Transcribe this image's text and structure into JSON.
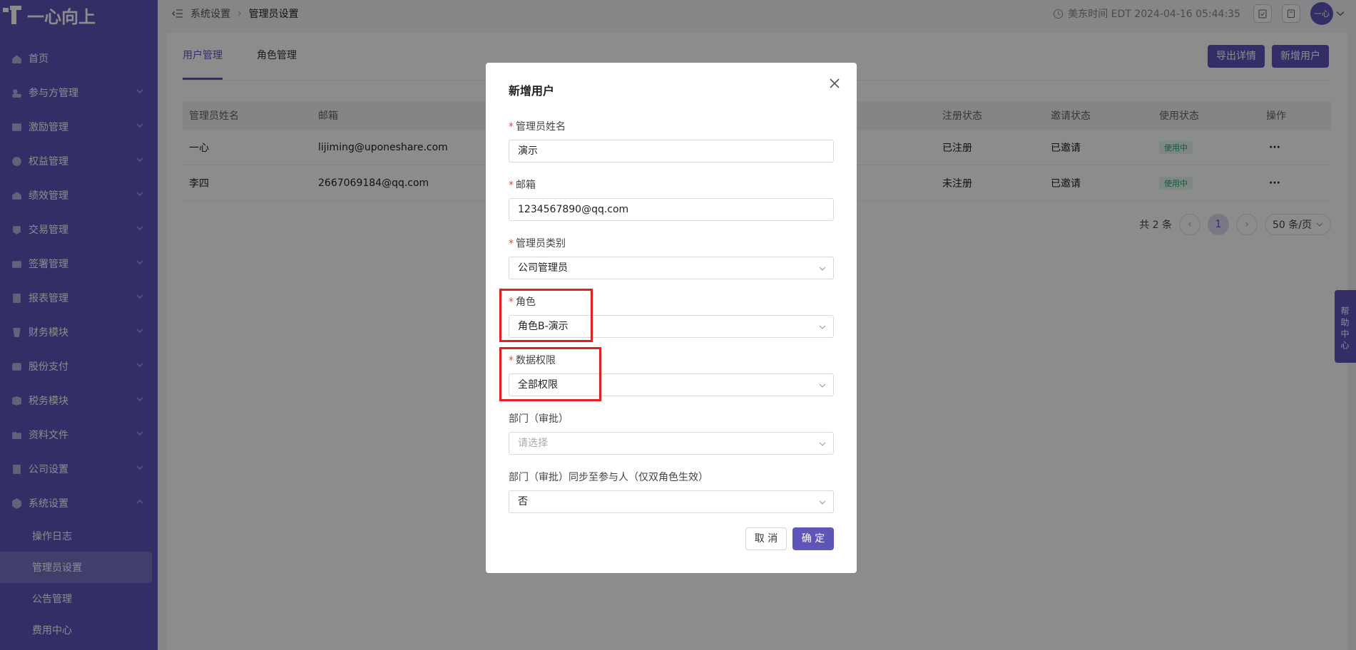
{
  "app": {
    "logo_text": "一心向上"
  },
  "sidebar": {
    "items": [
      {
        "label": "首页",
        "icon": "home-icon"
      },
      {
        "label": "参与方管理",
        "icon": "participants-icon"
      },
      {
        "label": "激励管理",
        "icon": "incentive-icon"
      },
      {
        "label": "权益管理",
        "icon": "equity-icon"
      },
      {
        "label": "绩效管理",
        "icon": "performance-icon"
      },
      {
        "label": "交易管理",
        "icon": "trade-icon"
      },
      {
        "label": "签署管理",
        "icon": "sign-icon"
      },
      {
        "label": "报表管理",
        "icon": "report-icon"
      },
      {
        "label": "财务模块",
        "icon": "finance-icon"
      },
      {
        "label": "股份支付",
        "icon": "share-payment-icon"
      },
      {
        "label": "税务模块",
        "icon": "tax-icon"
      },
      {
        "label": "资料文件",
        "icon": "files-icon"
      },
      {
        "label": "公司设置",
        "icon": "company-icon"
      },
      {
        "label": "系统设置",
        "icon": "system-icon"
      }
    ],
    "sub_items": [
      {
        "label": "操作日志"
      },
      {
        "label": "管理员设置"
      },
      {
        "label": "公告管理"
      },
      {
        "label": "费用中心"
      }
    ]
  },
  "header": {
    "breadcrumb_root": "系统设置",
    "breadcrumb_current": "管理员设置",
    "time_text": "美东时间 EDT 2024-04-16 05:44:35",
    "avatar_text": "一心"
  },
  "main": {
    "tabs": [
      {
        "label": "用户管理"
      },
      {
        "label": "角色管理"
      }
    ],
    "export_label": "导出详情",
    "add_label": "新增用户",
    "table": {
      "headers": {
        "name": "管理员姓名",
        "email": "邮箱",
        "reg": "注册状态",
        "invite": "邀请状态",
        "use": "使用状态",
        "op": "操作"
      },
      "rows": [
        {
          "name": "一心",
          "email": "lijiming@uponeshare.com",
          "reg": "已注册",
          "invite": "已邀请",
          "use": "使用中",
          "op": "···"
        },
        {
          "name": "李四",
          "email": "2667069184@qq.com",
          "reg": "未注册",
          "invite": "已邀请",
          "use": "使用中",
          "op": "···"
        }
      ]
    },
    "pager": {
      "total": "共 2 条",
      "page": "1",
      "size": "50 条/页"
    }
  },
  "help_text": "帮助中心",
  "modal": {
    "title": "新增用户",
    "fields": [
      {
        "label": "管理员姓名",
        "required": "*",
        "value": "演示"
      },
      {
        "label": "邮箱",
        "required": "*",
        "value": "1234567890@qq.com"
      },
      {
        "label": "管理员类别",
        "required": "*",
        "value": "公司管理员"
      },
      {
        "label": "角色",
        "required": "*",
        "value": "角色B-演示"
      },
      {
        "label": "数据权限",
        "required": "*",
        "value": "全部权限"
      },
      {
        "label": "部门（审批）",
        "placeholder": "请选择"
      },
      {
        "label": "部门（审批）同步至参与人（仅双角色生效）",
        "value": "否"
      }
    ],
    "cancel_label": "取 消",
    "ok_label": "确 定"
  },
  "colors": {
    "brand": "#5d55b8",
    "highlight": "#e0211f",
    "status_green": "#22a86a"
  }
}
